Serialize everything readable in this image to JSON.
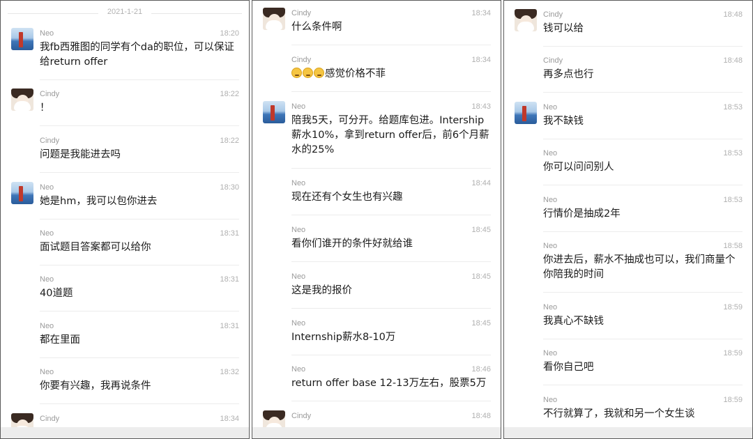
{
  "panels": [
    {
      "date": "2021-1-21",
      "messages": [
        {
          "sender": "Neo",
          "time": "18:20",
          "text": "我fb西雅图的同学有个da的职位，可以保证给return offer",
          "avatar": "neo-avatar"
        },
        {
          "sender": "Cindy",
          "time": "18:22",
          "text": "！",
          "avatar": "cindy-avatar"
        },
        {
          "sender": "Cindy",
          "time": "18:22",
          "text": "问题是我能进去吗"
        },
        {
          "sender": "Neo",
          "time": "18:30",
          "text": "她是hm，我可以包你进去",
          "avatar": "neo-avatar"
        },
        {
          "sender": "Neo",
          "time": "18:31",
          "text": "面试题目答案都可以给你"
        },
        {
          "sender": "Neo",
          "time": "18:31",
          "text": "40道题"
        },
        {
          "sender": "Neo",
          "time": "18:31",
          "text": "都在里面"
        },
        {
          "sender": "Neo",
          "time": "18:32",
          "text": "你要有兴趣，我再说条件"
        },
        {
          "sender": "Cindy",
          "time": "18:34",
          "text": "",
          "avatar": "cindy-avatar"
        }
      ]
    },
    {
      "messages": [
        {
          "sender": "Cindy",
          "time": "18:34",
          "text": "什么条件啊",
          "avatar": "cindy-avatar"
        },
        {
          "sender": "Cindy",
          "time": "18:34",
          "text": "感觉价格不菲",
          "emojis": [
            "grimace-emoji",
            "grimace-emoji",
            "grimace-emoji"
          ]
        },
        {
          "sender": "Neo",
          "time": "18:43",
          "text": "陪我5天，可分开。给题库包进。Intership薪水10%，拿到return offer后，前6个月薪水的25%",
          "avatar": "neo-avatar"
        },
        {
          "sender": "Neo",
          "time": "18:44",
          "text": "现在还有个女生也有兴趣"
        },
        {
          "sender": "Neo",
          "time": "18:45",
          "text": "看你们谁开的条件好就给谁"
        },
        {
          "sender": "Neo",
          "time": "18:45",
          "text": "这是我的报价"
        },
        {
          "sender": "Neo",
          "time": "18:45",
          "text": "Internship薪水8-10万"
        },
        {
          "sender": "Neo",
          "time": "18:46",
          "text": "return offer base 12-13万左右，股票5万"
        },
        {
          "sender": "Cindy",
          "time": "18:48",
          "text": "",
          "avatar": "cindy-avatar"
        }
      ]
    },
    {
      "messages": [
        {
          "sender": "Cindy",
          "time": "18:48",
          "text": "钱可以给",
          "avatar": "cindy-avatar"
        },
        {
          "sender": "Cindy",
          "time": "18:48",
          "text": "再多点也行"
        },
        {
          "sender": "Neo",
          "time": "18:53",
          "text": "我不缺钱",
          "avatar": "neo-avatar"
        },
        {
          "sender": "Neo",
          "time": "18:53",
          "text": "你可以问问别人"
        },
        {
          "sender": "Neo",
          "time": "18:53",
          "text": "行情价是抽成2年"
        },
        {
          "sender": "Neo",
          "time": "18:58",
          "text": "你进去后，薪水不抽成也可以，我们商量个你陪我的时间"
        },
        {
          "sender": "Neo",
          "time": "18:59",
          "text": "我真心不缺钱"
        },
        {
          "sender": "Neo",
          "time": "18:59",
          "text": "看你自己吧"
        },
        {
          "sender": "Neo",
          "time": "18:59",
          "text": "不行就算了，我就和另一个女生谈"
        }
      ]
    }
  ]
}
